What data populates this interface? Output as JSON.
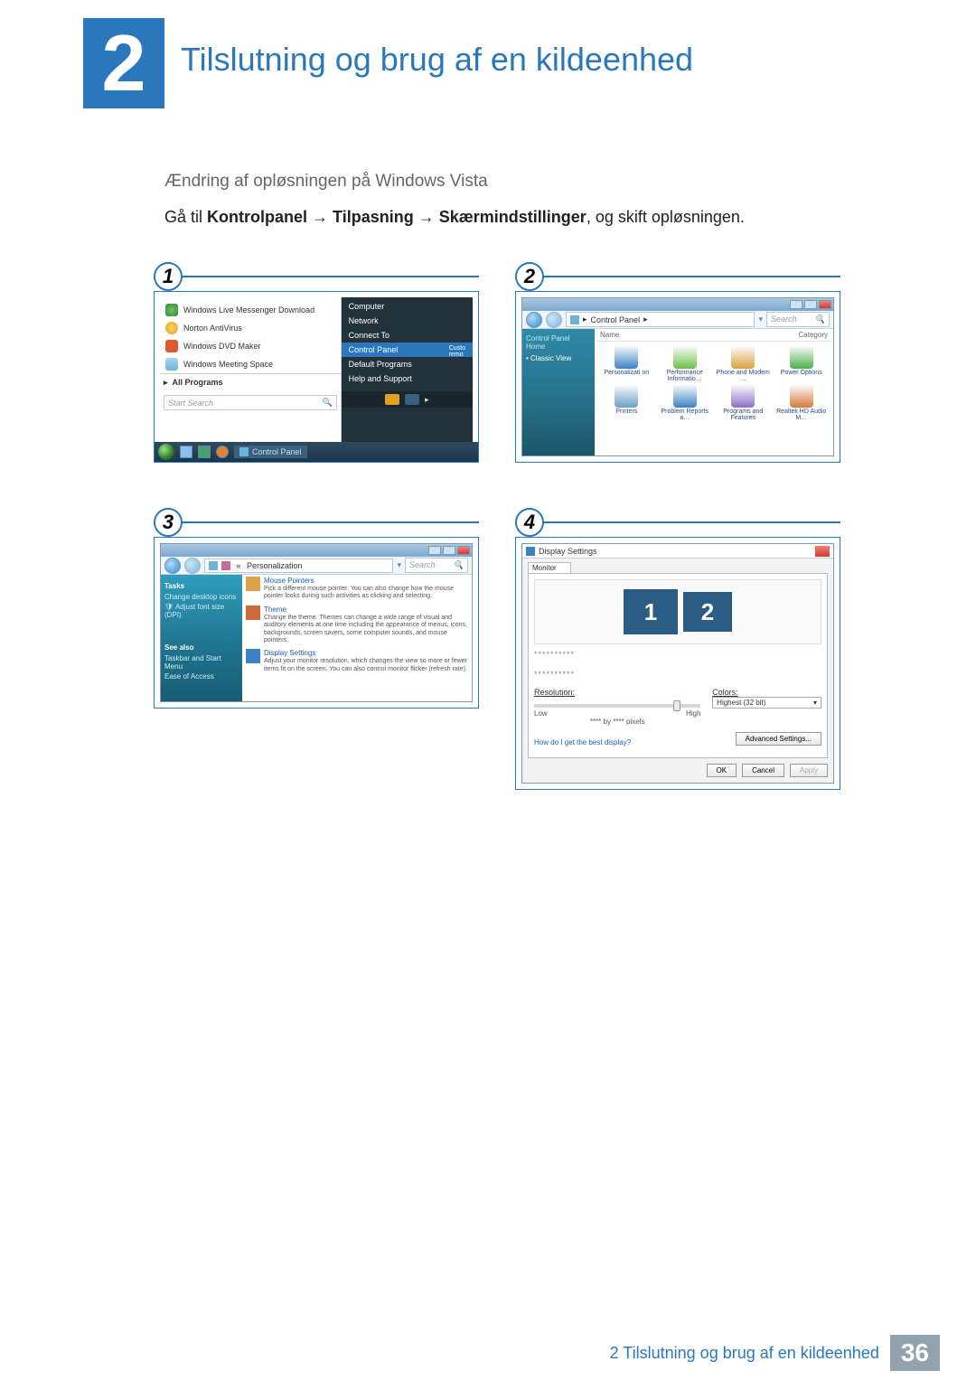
{
  "chapter": {
    "number": "2",
    "title": "Tilslutning og brug af en kildeenhed"
  },
  "subhead": "Ændring af opløsningen på Windows Vista",
  "instr": {
    "pre": "Gå til ",
    "p1": "Kontrolpanel",
    "p2": "Tilpasning",
    "p3": "Skærmindstillinger",
    "post": ", og skift opløsningen."
  },
  "arrow": "→",
  "steps": {
    "n1": "1",
    "n2": "2",
    "n3": "3",
    "n4": "4"
  },
  "s1": {
    "leftItems": [
      "Windows Live Messenger Download",
      "Norton AntiVirus",
      "Windows DVD Maker",
      "Windows Meeting Space"
    ],
    "allPrograms": "All Programs",
    "allProgramsIcon": "▸",
    "searchPlaceholder": "Start Search",
    "searchIcon": "🔍",
    "rightItems": [
      "Computer",
      "Network",
      "Connect To",
      "Control Panel",
      "Default Programs",
      "Help and Support"
    ],
    "rightHiIndex": 3,
    "rightExtra": [
      "Custo",
      "remo"
    ],
    "taskbarBtn": "Control Panel"
  },
  "s2": {
    "crumb": "Control Panel",
    "crumbSep": "▸",
    "search": "Search",
    "side": {
      "home": "Control Panel Home",
      "classic": "Classic View"
    },
    "cols": {
      "name": "Name",
      "cat": "Category"
    },
    "items": [
      "Personalizati on",
      "Performance Informatio…",
      "Phone and Modem …",
      "Power Options",
      "Printers",
      "Problem Reports a…",
      "Programs and Features",
      "Realtek HD Audio M…"
    ],
    "iconColors": [
      "#3b82c4",
      "#6fbf4b",
      "#d6a23c",
      "#4cae4c",
      "#6aa0c8",
      "#3b82c4",
      "#8a6fc7",
      "#d47a3b"
    ]
  },
  "s3": {
    "crumb": "Personalization",
    "search": "Search",
    "side": {
      "tasks": "Tasks",
      "links1": [
        "Change desktop icons",
        "Adjust font size (DPI)"
      ],
      "seeAlso": "See also",
      "links2": [
        "Taskbar and Start Menu",
        "Ease of Access"
      ]
    },
    "main": [
      {
        "title": "Mouse Pointers",
        "desc": "Pick a different mouse pointer. You can also change how the mouse pointer looks during such activities as clicking and selecting."
      },
      {
        "title": "Theme",
        "desc": "Change the theme. Themes can change a wide range of visual and auditory elements at one time including the appearance of menus, icons, backgrounds, screen savers, some computer sounds, and mouse pointers."
      },
      {
        "title": "Display Settings",
        "desc": "Adjust your monitor resolution, which changes the view so more or fewer items fit on the screen. You can also control monitor flicker (refresh rate)."
      }
    ],
    "iconColors": [
      "#e0a24a",
      "#cc6a3a",
      "#3b82c4"
    ]
  },
  "s4": {
    "title": "Display Settings",
    "tab": "Monitor",
    "mon1": "1",
    "mon2": "2",
    "blur": "**********",
    "resLabel": "Resolution:",
    "low": "Low",
    "high": "High",
    "pixels": "**** by **** pixels",
    "colorsLabel": "Colors:",
    "colorsVal": "Highest (32 bit)",
    "help": "How do I get the best display?",
    "adv": "Advanced Settings...",
    "ok": "OK",
    "cancel": "Cancel",
    "apply": "Apply"
  },
  "footer": {
    "label": "2 Tilslutning og brug af en kildeenhed",
    "page": "36"
  }
}
